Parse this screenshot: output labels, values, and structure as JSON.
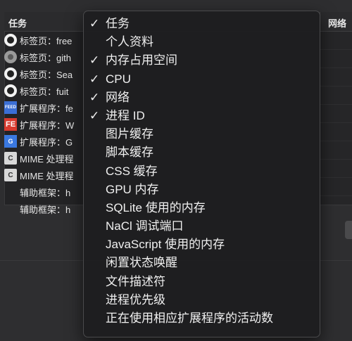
{
  "table": {
    "header_task": "任务",
    "header_network": "网络",
    "rows": [
      {
        "icon": "github-icon",
        "label": "标签页：free"
      },
      {
        "icon": "globe-icon",
        "label": "标签页：gith"
      },
      {
        "icon": "github-icon",
        "label": "标签页：Sea"
      },
      {
        "icon": "github-icon",
        "label": "标签页：fuit"
      },
      {
        "icon": "feed-extension-icon",
        "label": "扩展程序：fe"
      },
      {
        "icon": "fe-extension-icon",
        "label": "扩展程序：W"
      },
      {
        "icon": "google-translate-icon",
        "label": "扩展程序：G"
      },
      {
        "icon": "document-icon",
        "label": "MIME 处理程"
      },
      {
        "icon": "document-icon",
        "label": "MIME 处理程"
      },
      {
        "icon": "none",
        "label": "辅助框架：h"
      },
      {
        "icon": "none",
        "label": "辅助框架：h"
      }
    ],
    "icon_glyphs": {
      "feed": "FEED",
      "fe": "FE",
      "gx": "G",
      "cdoc": "C"
    }
  },
  "menu": {
    "check_glyph": "✓",
    "items": [
      {
        "label": "任务",
        "checked": true
      },
      {
        "label": "个人资料",
        "checked": false
      },
      {
        "label": "内存占用空间",
        "checked": true
      },
      {
        "label": "CPU",
        "checked": true
      },
      {
        "label": "网络",
        "checked": true
      },
      {
        "label": "进程 ID",
        "checked": true
      },
      {
        "label": "图片缓存",
        "checked": false
      },
      {
        "label": "脚本缓存",
        "checked": false
      },
      {
        "label": "CSS 缓存",
        "checked": false
      },
      {
        "label": "GPU 内存",
        "checked": false
      },
      {
        "label": "SQLite 使用的内存",
        "checked": false
      },
      {
        "label": "NaCl 调试端口",
        "checked": false
      },
      {
        "label": "JavaScript 使用的内存",
        "checked": false
      },
      {
        "label": "闲置状态唤醒",
        "checked": false
      },
      {
        "label": "文件描述符",
        "checked": false
      },
      {
        "label": "进程优先级",
        "checked": false
      },
      {
        "label": "正在使用相应扩展程序的活动数",
        "checked": false
      }
    ]
  }
}
